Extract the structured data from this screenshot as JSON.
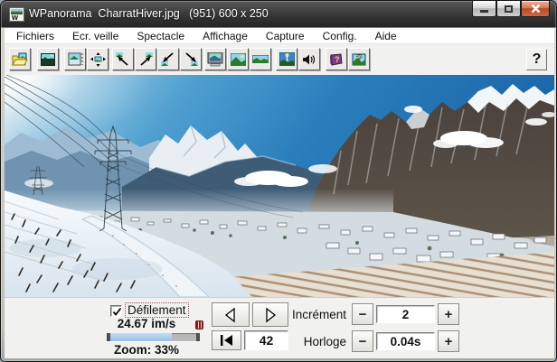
{
  "window": {
    "title": "WPanorama  CharratHiver.jpg   (951) 600 x 250",
    "buttons": [
      "minimize",
      "maximize",
      "close"
    ]
  },
  "menubar": {
    "items": [
      "Fichiers",
      "Ecr. veille",
      "Spectacle",
      "Affichage",
      "Capture",
      "Config.",
      "Aide"
    ]
  },
  "toolbar": {
    "help_label": "?",
    "icons": [
      "open-image",
      "screensaver",
      "window-image",
      "pan-arrows",
      "scroll-up-left",
      "scroll-up-right",
      "scroll-down-left",
      "scroll-down-right",
      "monitor-image",
      "fullscreen-image",
      "panorama-strip",
      "mast-image",
      "speaker",
      "help-book",
      "about-image"
    ]
  },
  "controls": {
    "defilement": {
      "label": "Défilement",
      "checked": true
    },
    "fps": "24.67 im/s",
    "zoom": "Zoom: 33%",
    "slider_fill": "66%",
    "frame_counter": "42",
    "increment": {
      "label": "Incrément",
      "minus": "−",
      "plus": "+",
      "value": "2"
    },
    "horloge": {
      "label": "Horloge",
      "minus": "−",
      "plus": "+",
      "value": "0.04s"
    }
  },
  "colors": {
    "accent_sky": "#2a7ebc",
    "close_button": "#bc4a28",
    "slider_fill": "#98bfe6"
  }
}
